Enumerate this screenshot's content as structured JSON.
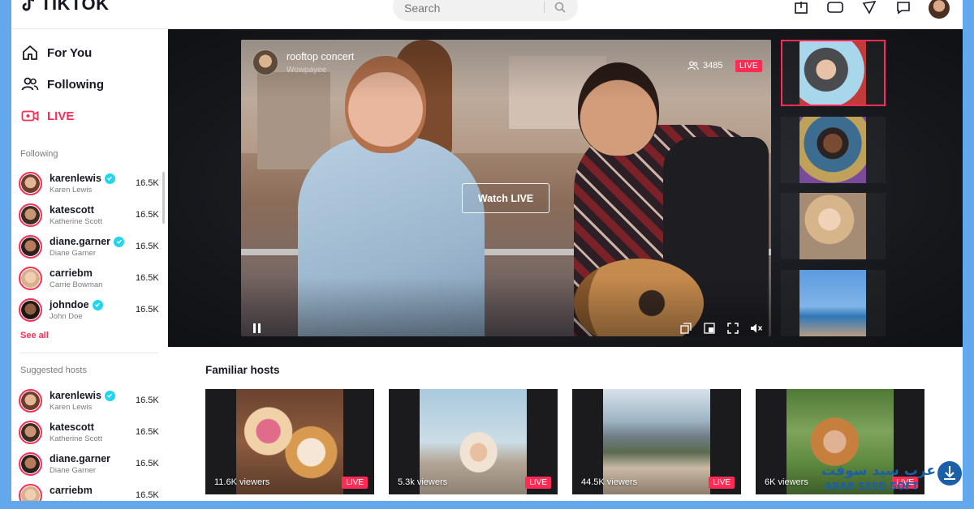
{
  "app": {
    "logo_text": "TikTok"
  },
  "search": {
    "placeholder": "Search"
  },
  "nav": {
    "for_you": "For You",
    "following": "Following",
    "live": "LIVE"
  },
  "sidebar": {
    "following_heading": "Following",
    "following": [
      {
        "user": "karenlewis",
        "name": "Karen Lewis",
        "count": "16.5K",
        "verified": true
      },
      {
        "user": "katescott",
        "name": "Katherine Scott",
        "count": "16.5K",
        "verified": false
      },
      {
        "user": "diane.garner",
        "name": "Diane Garner",
        "count": "16.5K",
        "verified": true
      },
      {
        "user": "carriebm",
        "name": "Carrie Bowman",
        "count": "16.5K",
        "verified": false
      },
      {
        "user": "johndoe",
        "name": "John Doe",
        "count": "16.5K",
        "verified": true
      }
    ],
    "see_all": "See all",
    "suggested_heading": "Suggested hosts",
    "suggested": [
      {
        "user": "karenlewis",
        "name": "Karen Lewis",
        "count": "16.5K",
        "verified": true
      },
      {
        "user": "katescott",
        "name": "Katherine Scott",
        "count": "16.5K",
        "verified": false
      },
      {
        "user": "diane.garner",
        "name": "Diane Garner",
        "count": "16.5K",
        "verified": false
      },
      {
        "user": "carriebm",
        "name": "",
        "count": "16.5K",
        "verified": false
      }
    ]
  },
  "player": {
    "title": "rooftop concert",
    "host": "Wowpayee",
    "viewers": "3485",
    "live_badge": "LIVE",
    "watch_label": "Watch LIVE"
  },
  "familiar": {
    "heading": "Familiar hosts",
    "cards": [
      {
        "viewers": "11.6K viewers",
        "badge": "LIVE"
      },
      {
        "viewers": "5.3k viewers",
        "badge": "LIVE"
      },
      {
        "viewers": "44.5K viewers",
        "badge": "LIVE"
      },
      {
        "viewers": "6K viewers",
        "badge": "LIVE"
      }
    ]
  },
  "watermark": {
    "text": "عرب سيد سوفت",
    "latin": "ARAB SEED SOFT"
  },
  "colors": {
    "accent": "#fe2c55",
    "verified": "#20d5ec",
    "background": "#63a8ec"
  }
}
